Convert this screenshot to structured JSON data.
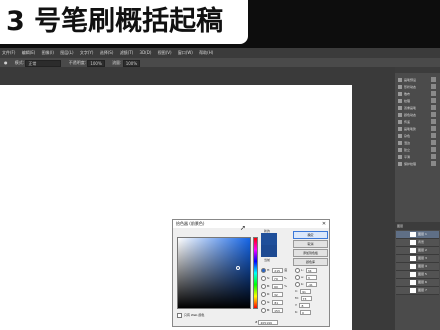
{
  "title": "3 号笔刷概括起稿",
  "menu": [
    "文件(F)",
    "编辑(E)",
    "图像(I)",
    "图层(L)",
    "文字(Y)",
    "选择(S)",
    "滤镜(T)",
    "3D(D)",
    "视图(V)",
    "窗口(W)",
    "帮助(H)"
  ],
  "options": {
    "mode_label": "模式:",
    "mode_value": "正常",
    "opacity_label": "不透明度:",
    "opacity_value": "100%",
    "flow_label": "流量:",
    "flow_value": "100%"
  },
  "right_panel": {
    "items": [
      "画笔预设",
      "形状动态",
      "散布",
      "纹理",
      "双重画笔",
      "颜色动态",
      "传递",
      "画笔笔势",
      "杂色",
      "湿边",
      "建立",
      "平滑",
      "保护纹理"
    ]
  },
  "layers": {
    "header": "图层",
    "rows": [
      "图层 1",
      "背景",
      "图层 2",
      "图层 3",
      "图层 4",
      "图层 5",
      "图层 6",
      "图层 7"
    ]
  },
  "picker": {
    "title": "拾色器 (前景色)",
    "new_label": "新的",
    "current_label": "当前",
    "buttons": [
      "确定",
      "取消",
      "添加到色板",
      "颜色库"
    ],
    "fields": [
      {
        "label": "H:",
        "value": "215",
        "unit": "度"
      },
      {
        "label": "S:",
        "value": "79",
        "unit": "%"
      },
      {
        "label": "B:",
        "value": "60",
        "unit": "%"
      },
      {
        "label": "R:",
        "value": "32",
        "unit": ""
      },
      {
        "label": "G:",
        "value": "81",
        "unit": ""
      },
      {
        "label": "B:",
        "value": "153",
        "unit": ""
      }
    ],
    "lab_fields": [
      {
        "label": "L:",
        "value": "34"
      },
      {
        "label": "a:",
        "value": "3"
      },
      {
        "label": "b:",
        "value": "-41"
      },
      {
        "label": "C:",
        "value": "91"
      },
      {
        "label": "M:",
        "value": "73"
      },
      {
        "label": "Y:",
        "value": "8"
      },
      {
        "label": "K:",
        "value": "0"
      }
    ],
    "hex_label": "#",
    "hex_value": "205199",
    "only_web_label": "只有 Web 颜色"
  }
}
